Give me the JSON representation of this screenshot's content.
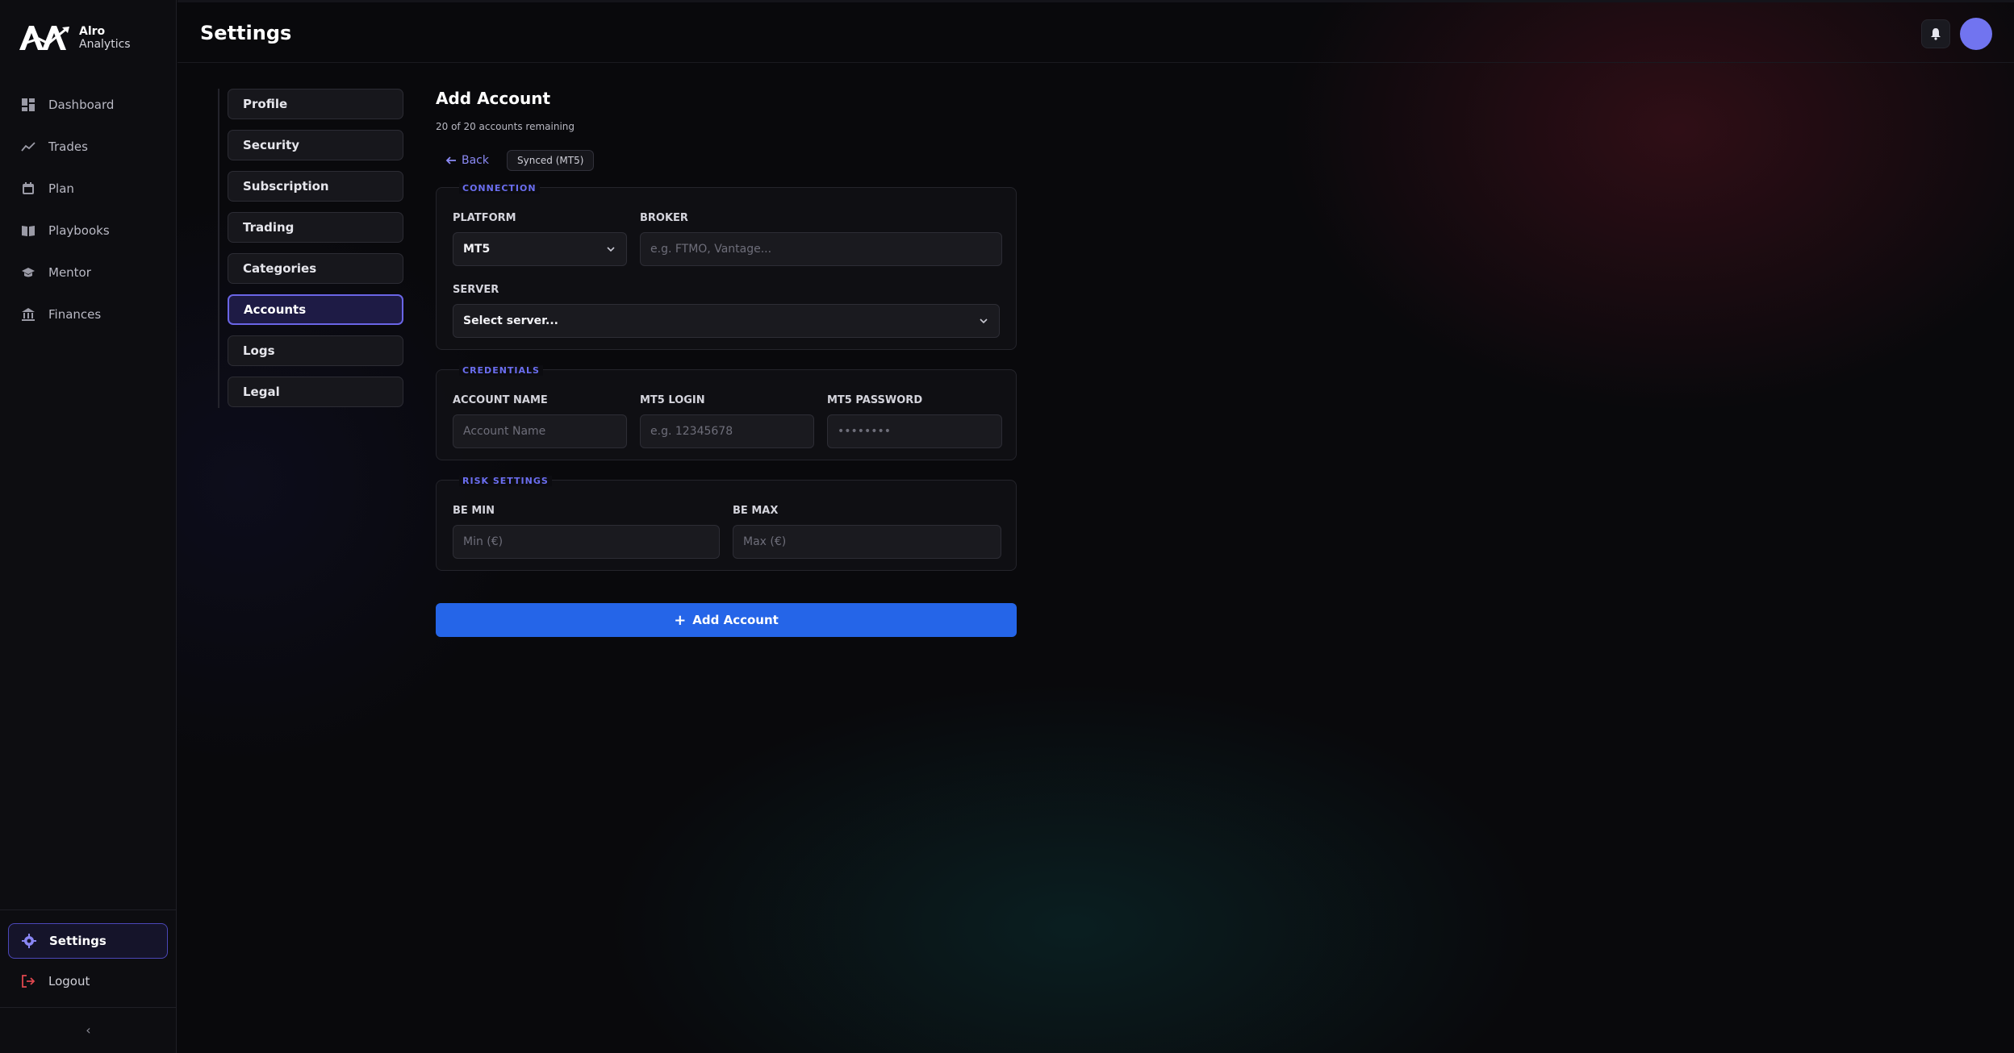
{
  "brand": {
    "line1": "Alro",
    "line2": "Analytics",
    "logo_icon": "aa-logo"
  },
  "header": {
    "title": "Settings",
    "bell_icon": "bell-icon"
  },
  "sidebar": {
    "items": [
      {
        "label": "Dashboard",
        "icon": "grid-icon"
      },
      {
        "label": "Trades",
        "icon": "trend-icon"
      },
      {
        "label": "Plan",
        "icon": "calendar-icon"
      },
      {
        "label": "Playbooks",
        "icon": "book-icon"
      },
      {
        "label": "Mentor",
        "icon": "graduation-cap-icon"
      },
      {
        "label": "Finances",
        "icon": "bank-icon"
      }
    ],
    "settings_label": "Settings",
    "logout_label": "Logout",
    "collapse_glyph": "‹"
  },
  "subnav": {
    "items": [
      {
        "label": "Profile"
      },
      {
        "label": "Security"
      },
      {
        "label": "Subscription"
      },
      {
        "label": "Trading"
      },
      {
        "label": "Categories"
      },
      {
        "label": "Accounts",
        "active": true
      },
      {
        "label": "Logs"
      },
      {
        "label": "Legal"
      }
    ]
  },
  "form": {
    "title": "Add Account",
    "subtitle": "20 of 20 accounts remaining",
    "back_label": "Back",
    "synced_badge": "Synced (MT5)",
    "connection": {
      "legend": "CONNECTION",
      "platform_label": "PLATFORM",
      "platform_value": "MT5",
      "broker_label": "BROKER",
      "broker_placeholder": "e.g. FTMO, Vantage...",
      "server_label": "SERVER",
      "server_value": "Select server..."
    },
    "credentials": {
      "legend": "CREDENTIALS",
      "account_name_label": "ACCOUNT NAME",
      "account_name_placeholder": "Account Name",
      "login_label": "MT5 LOGIN",
      "login_placeholder": "e.g. 12345678",
      "password_label": "MT5 PASSWORD",
      "password_placeholder": "••••••••"
    },
    "risk": {
      "legend": "RISK SETTINGS",
      "be_min_label": "BE MIN",
      "be_min_placeholder": "Min (€)",
      "be_max_label": "BE MAX",
      "be_max_placeholder": "Max (€)"
    },
    "submit_label": "Add Account"
  },
  "colors": {
    "accent": "#6a65e6",
    "primary_button": "#2565e8",
    "avatar": "#7174f0"
  }
}
